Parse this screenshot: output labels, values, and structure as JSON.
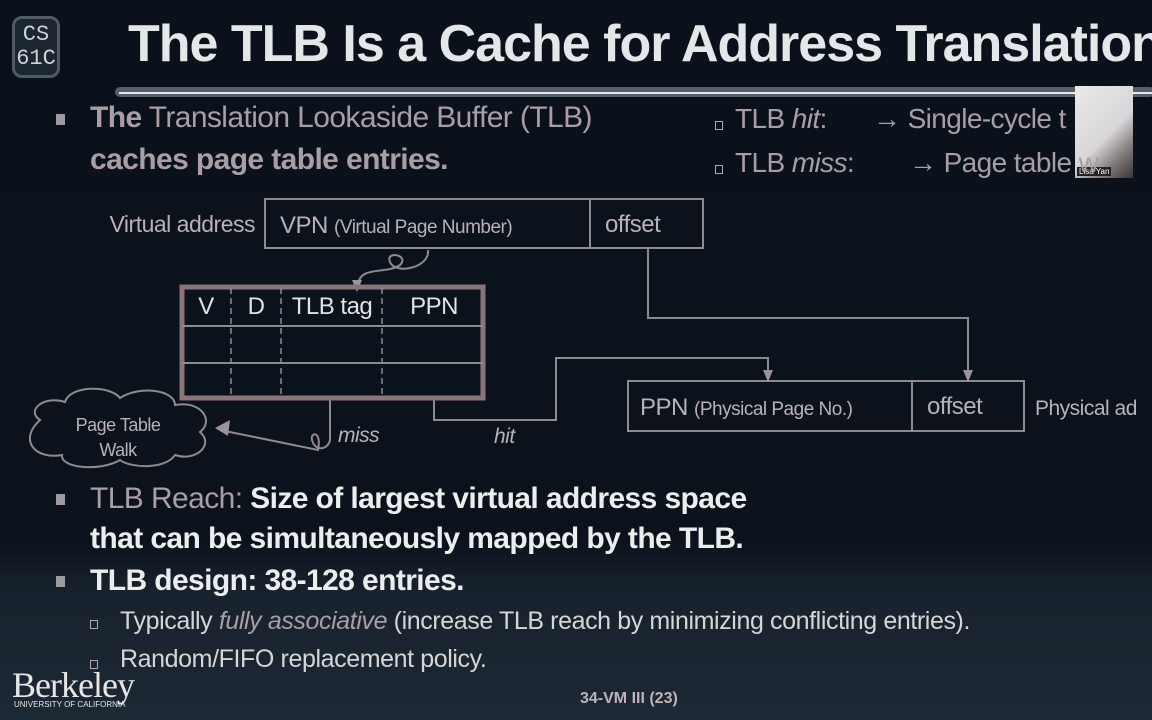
{
  "logo": {
    "line1": "CS",
    "line2": "61C"
  },
  "title": "The TLB Is a Cache for Address Translation",
  "webcam": {
    "name_label": "Lisa Yan"
  },
  "bullet1": {
    "lead": "The",
    "rest": " Translation Lookaside Buffer (TLB)",
    "line2": "caches page table entries."
  },
  "side": [
    {
      "pre": "TLB ",
      "em": "hit",
      "post": ":",
      "arrow": "→ Single-cycle t"
    },
    {
      "pre": "TLB ",
      "em": "miss",
      "post": ":",
      "arrow": "→ Page table w"
    }
  ],
  "diagram": {
    "virtual_label": "Virtual address",
    "vpn": "VPN",
    "vpn_desc": "(Virtual Page Number)",
    "offset": "offset",
    "tlb_headers": [
      "V",
      "D",
      "TLB tag",
      "PPN"
    ],
    "physical_label": "Physical ad",
    "ppn": "PPN",
    "ppn_desc": "(Physical Page No.)",
    "offset2": "offset",
    "cloud_line1": "Page Table",
    "cloud_line2": "Walk",
    "miss": "miss",
    "hit": "hit"
  },
  "bullet2": {
    "lead": "TLB Reach",
    "colon": ":",
    "rest": " Size of largest virtual address space",
    "line2": "that can be simultaneously mapped by the TLB."
  },
  "bullet3": "TLB design: 38-128 entries.",
  "sub1": {
    "pre": "Typically ",
    "em": "fully associative",
    "post": " (increase TLB reach by minimizing conflicting entries)."
  },
  "sub2": "Random/FIFO replacement policy.",
  "footer": {
    "berkeley": "Berkeley",
    "university": "UNIVERSITY OF CALIFORNIA",
    "page": "34-VM III (23)"
  },
  "colors": {
    "background": "#0a111b",
    "title": "#e4e7e7",
    "tlb_border": "#8a7479",
    "line": "#8f8a8f"
  }
}
